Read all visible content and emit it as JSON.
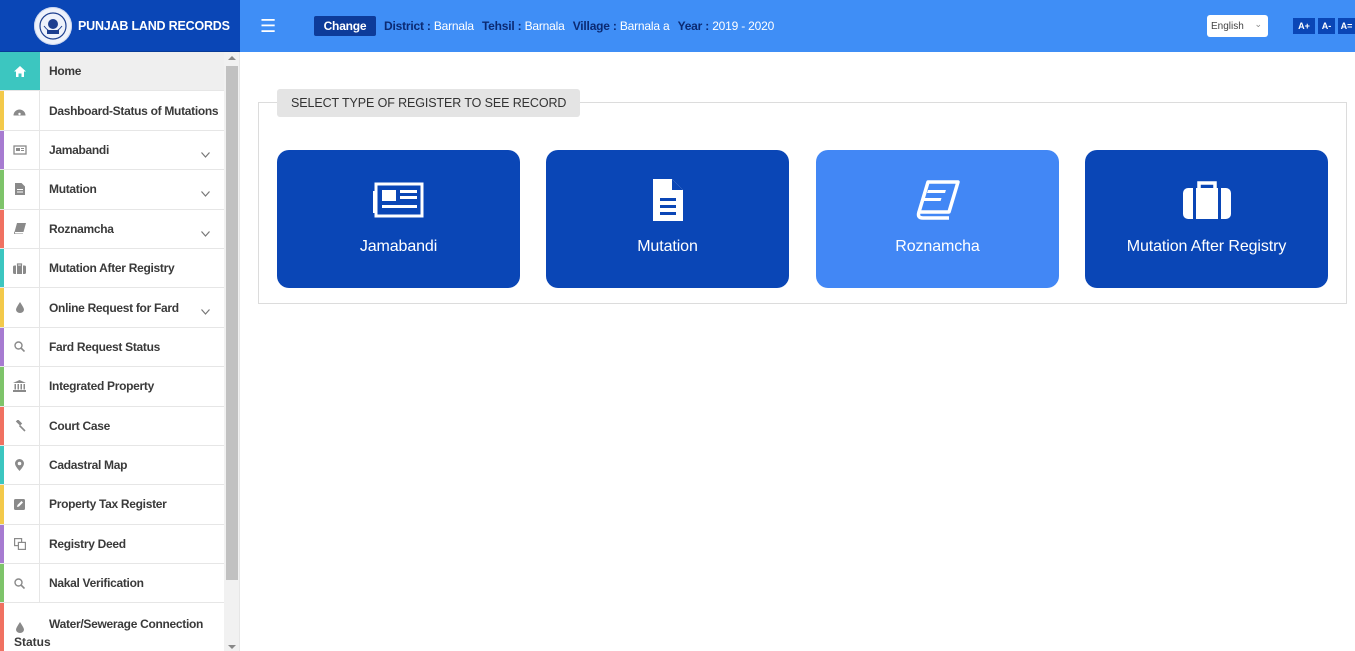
{
  "brand": {
    "title": "PUNJAB LAND RECORDS"
  },
  "topbar": {
    "change_label": "Change",
    "district_key": "District :",
    "district_val": "Barnala",
    "tehsil_key": "Tehsil :",
    "tehsil_val": "Barnala",
    "village_key": "Village :",
    "village_val": "Barnala a",
    "year_key": "Year :",
    "year_val": "2019 - 2020",
    "language": "English",
    "font_plus": "A+",
    "font_minus": "A-",
    "font_reset": "A="
  },
  "sidebar": {
    "items": [
      {
        "label": "Home",
        "icon": "home-icon",
        "stripe": "#3cc6c0"
      },
      {
        "label": "Dashboard-Status of Mutations",
        "icon": "dashboard-icon",
        "stripe": "#f3c94a"
      },
      {
        "label": "Jamabandi",
        "icon": "newspaper-icon",
        "stripe": "#a77bd1"
      },
      {
        "label": "Mutation",
        "icon": "file-icon",
        "stripe": "#7ec46a"
      },
      {
        "label": "Roznamcha",
        "icon": "book-icon",
        "stripe": "#f07161"
      },
      {
        "label": "Mutation After Registry",
        "icon": "briefcase-icon",
        "stripe": "#3cc6c0"
      },
      {
        "label": "Online Request for Fard",
        "icon": "drop-icon",
        "stripe": "#f3c94a"
      },
      {
        "label": "Fard Request Status",
        "icon": "search-icon",
        "stripe": "#a77bd1"
      },
      {
        "label": "Integrated Property",
        "icon": "bank-icon",
        "stripe": "#7ec46a"
      },
      {
        "label": "Court Case",
        "icon": "gavel-icon",
        "stripe": "#f07161"
      },
      {
        "label": "Cadastral Map",
        "icon": "map-marker-icon",
        "stripe": "#3cc6c0"
      },
      {
        "label": "Property Tax Register",
        "icon": "edit-icon",
        "stripe": "#f3c94a"
      },
      {
        "label": "Registry Deed",
        "icon": "copy-icon",
        "stripe": "#a77bd1"
      },
      {
        "label": "Nakal Verification",
        "icon": "search-icon",
        "stripe": "#7ec46a"
      },
      {
        "label": "Water/Sewerage Connection",
        "label_tail": "Status",
        "icon": "drop-icon",
        "stripe": "#f07161"
      }
    ]
  },
  "main": {
    "panel_title": "SELECT TYPE OF REGISTER TO SEE RECORD",
    "cards": [
      {
        "label": "Jamabandi",
        "icon": "newspaper-icon",
        "color": "#0a46b6"
      },
      {
        "label": "Mutation",
        "icon": "file-text-icon",
        "color": "#0a46b6"
      },
      {
        "label": "Roznamcha",
        "icon": "book-icon",
        "color": "#4287f5"
      },
      {
        "label": "Mutation After Registry",
        "icon": "briefcase-icon",
        "color": "#0a46b6"
      }
    ]
  },
  "colors": {
    "brand_blue": "#0a46b6",
    "topbar_blue": "#3f8ef6",
    "card_light_blue": "#4287f5"
  }
}
